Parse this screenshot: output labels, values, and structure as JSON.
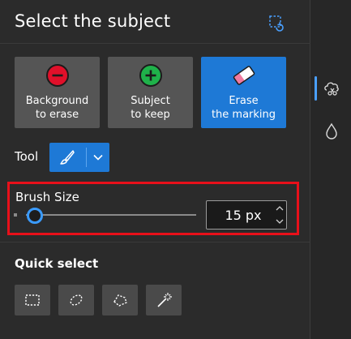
{
  "header": {
    "title": "Select the subject",
    "action_icon": "selection-undo-icon"
  },
  "modes": [
    {
      "line1": "Background",
      "line2": "to erase",
      "icon": "minus-circle-icon",
      "icon_color": "#e0102a"
    },
    {
      "line1": "Subject",
      "line2": "to keep",
      "icon": "plus-circle-icon",
      "icon_color": "#1fb24a"
    },
    {
      "line1": "Erase",
      "line2": "the marking",
      "icon": "eraser-icon",
      "selected": true
    }
  ],
  "tool": {
    "label": "Tool",
    "selected_icon": "brush-icon"
  },
  "brush": {
    "label": "Brush Size",
    "value": "15 px",
    "slider_fraction": 0.05
  },
  "quick_select": {
    "title": "Quick select",
    "tools": [
      "rectangle-select-icon",
      "lasso-select-icon",
      "polygon-lasso-icon",
      "magic-wand-icon"
    ]
  },
  "rail": {
    "items": [
      "remove-background-icon",
      "color-drop-icon"
    ]
  },
  "colors": {
    "accent": "#1e79d6",
    "highlight_box": "#e8101a",
    "panel_bg": "#2b2b2b"
  }
}
